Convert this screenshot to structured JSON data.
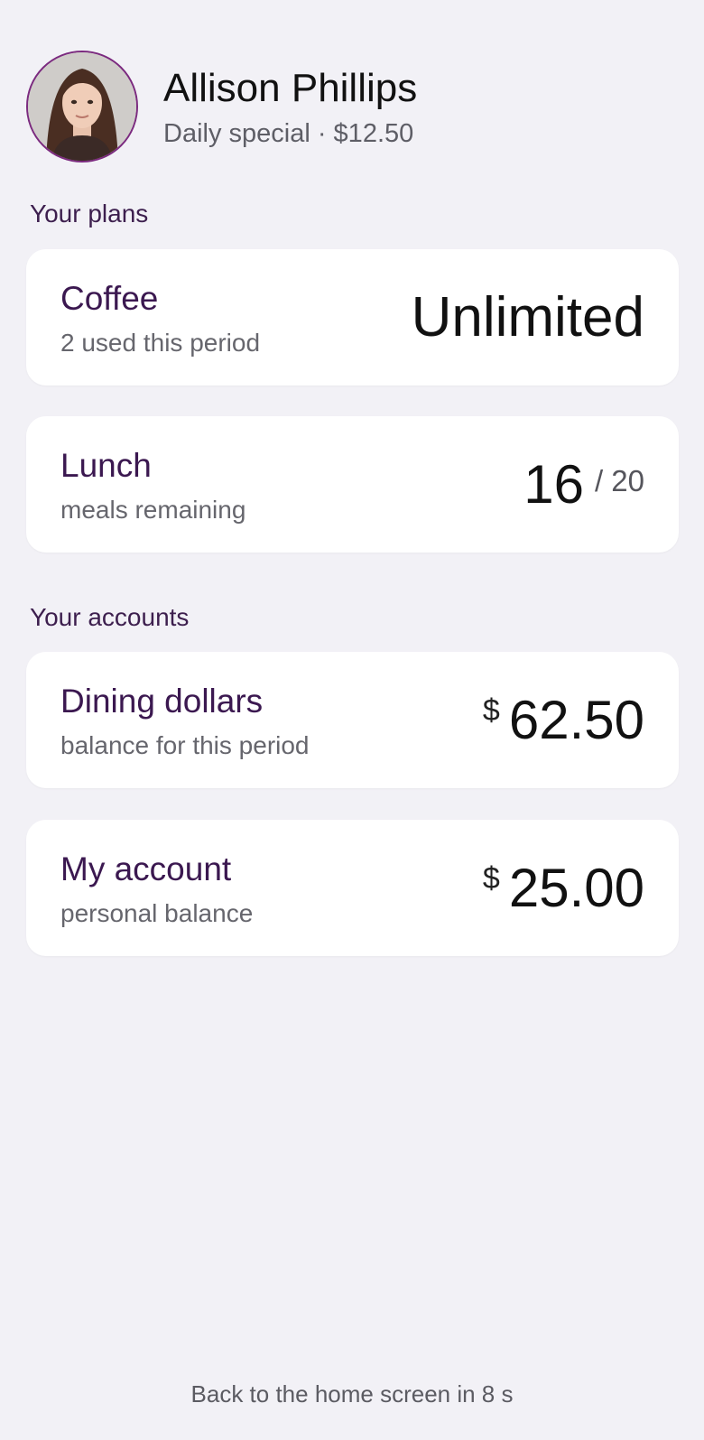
{
  "profile": {
    "name": "Allison Phillips",
    "subtitle": "Daily special · $12.50"
  },
  "plans": {
    "label": "Your plans",
    "coffee": {
      "title": "Coffee",
      "subtitle": "2 used this period",
      "value": "Unlimited"
    },
    "lunch": {
      "title": "Lunch",
      "subtitle": "meals remaining",
      "value": "16",
      "total": "/ 20"
    }
  },
  "accounts": {
    "label": "Your accounts",
    "dining": {
      "title": "Dining dollars",
      "subtitle": "balance for this period",
      "currency": "$",
      "value": "62.50"
    },
    "personal": {
      "title": "My account",
      "subtitle": "personal balance",
      "currency": "$",
      "value": "25.00"
    }
  },
  "footer": {
    "text": "Back to the home screen in 8 s"
  },
  "colors": {
    "background": "#f2f1f6",
    "card": "#ffffff",
    "accent": "#3b1850",
    "avatar_ring": "#7b2a7f"
  }
}
